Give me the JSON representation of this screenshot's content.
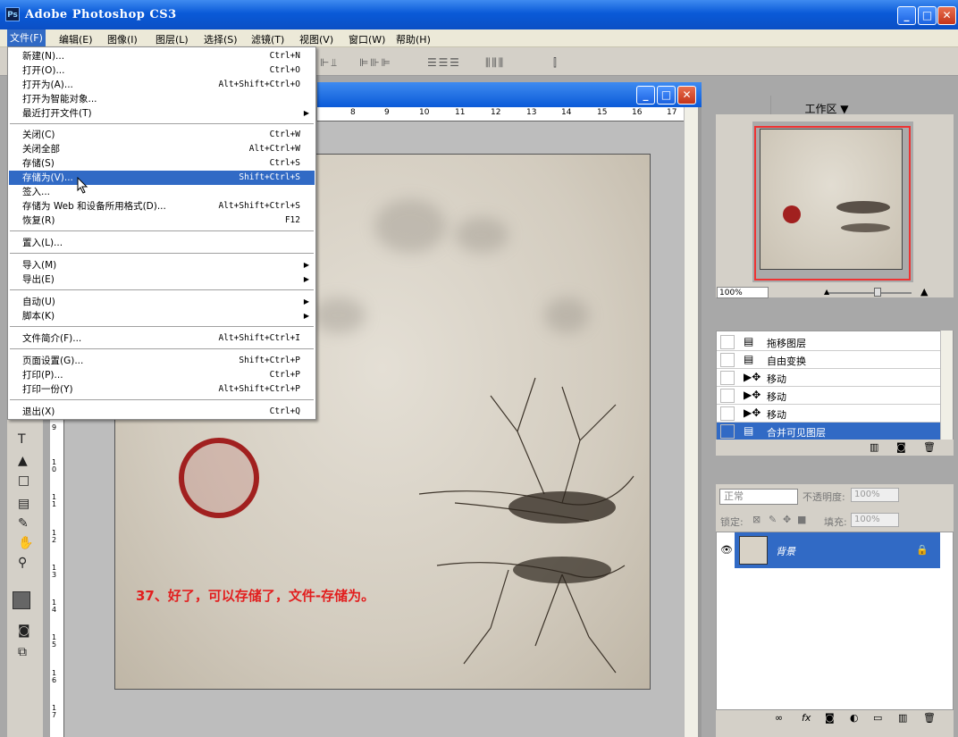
{
  "app": {
    "title": "Adobe Photoshop CS3",
    "icon_text": "Ps"
  },
  "window_buttons": {
    "minimize": "_",
    "maximize": "□",
    "close": "✕"
  },
  "menubar": {
    "items": [
      "文件(F)",
      "编辑(E)",
      "图像(I)",
      "图层(L)",
      "选择(S)",
      "滤镜(T)",
      "视图(V)",
      "窗口(W)",
      "帮助(H)"
    ]
  },
  "options_bar": {
    "workspace_label": "工作区 ▼"
  },
  "file_menu": {
    "items": [
      {
        "label": "新建(N)...",
        "shortcut": "Ctrl+N"
      },
      {
        "label": "打开(O)...",
        "shortcut": "Ctrl+O"
      },
      {
        "label": "打开为(A)...",
        "shortcut": "Alt+Shift+Ctrl+O"
      },
      {
        "label": "打开为智能对象...",
        "shortcut": ""
      },
      {
        "label": "最近打开文件(T)",
        "shortcut": "",
        "submenu": true
      },
      {
        "label": "关闭(C)",
        "shortcut": "Ctrl+W"
      },
      {
        "label": "关闭全部",
        "shortcut": "Alt+Ctrl+W"
      },
      {
        "label": "存储(S)",
        "shortcut": "Ctrl+S"
      },
      {
        "label": "存储为(V)...",
        "shortcut": "Shift+Ctrl+S",
        "highlighted": true
      },
      {
        "label": "签入...",
        "shortcut": ""
      },
      {
        "label": "存储为 Web 和设备所用格式(D)...",
        "shortcut": "Alt+Shift+Ctrl+S"
      },
      {
        "label": "恢复(R)",
        "shortcut": "F12"
      },
      {
        "label": "置入(L)...",
        "shortcut": ""
      },
      {
        "label": "导入(M)",
        "shortcut": "",
        "submenu": true
      },
      {
        "label": "导出(E)",
        "shortcut": "",
        "submenu": true
      },
      {
        "label": "自动(U)",
        "shortcut": "",
        "submenu": true
      },
      {
        "label": "脚本(K)",
        "shortcut": "",
        "submenu": true
      },
      {
        "label": "文件简介(F)...",
        "shortcut": "Alt+Shift+Ctrl+I"
      },
      {
        "label": "页面设置(G)...",
        "shortcut": "Shift+Ctrl+P"
      },
      {
        "label": "打印(P)...",
        "shortcut": "Ctrl+P"
      },
      {
        "label": "打印一份(Y)",
        "shortcut": "Alt+Shift+Ctrl+P"
      },
      {
        "label": "退出(X)",
        "shortcut": "Ctrl+Q"
      }
    ]
  },
  "ruler": {
    "h_ticks": [
      "8",
      "9",
      "10",
      "11",
      "12",
      "13",
      "14",
      "15",
      "16",
      "17"
    ],
    "v_ticks": [
      "9",
      "1 0",
      "1 1",
      "1 2",
      "1 3",
      "1 4",
      "1 5",
      "1 6",
      "1 7"
    ]
  },
  "canvas": {
    "caption": "37、好了，可以存储了，文件-存储为。"
  },
  "navigator": {
    "zoom": "100%"
  },
  "history": {
    "items": [
      {
        "label": "拖移图层",
        "icon": "doc-icon"
      },
      {
        "label": "自由变换",
        "icon": "doc-icon"
      },
      {
        "label": "移动",
        "icon": "move-icon"
      },
      {
        "label": "移动",
        "icon": "move-icon"
      },
      {
        "label": "移动",
        "icon": "move-icon"
      },
      {
        "label": "合并可见图层",
        "icon": "doc-icon",
        "selected": true
      }
    ]
  },
  "layers": {
    "blend_mode": "正常",
    "opacity_label": "不透明度:",
    "opacity_value": "100%",
    "lock_label": "锁定:",
    "fill_label": "填充:",
    "fill_value": "100%",
    "layer_name": "背景"
  }
}
